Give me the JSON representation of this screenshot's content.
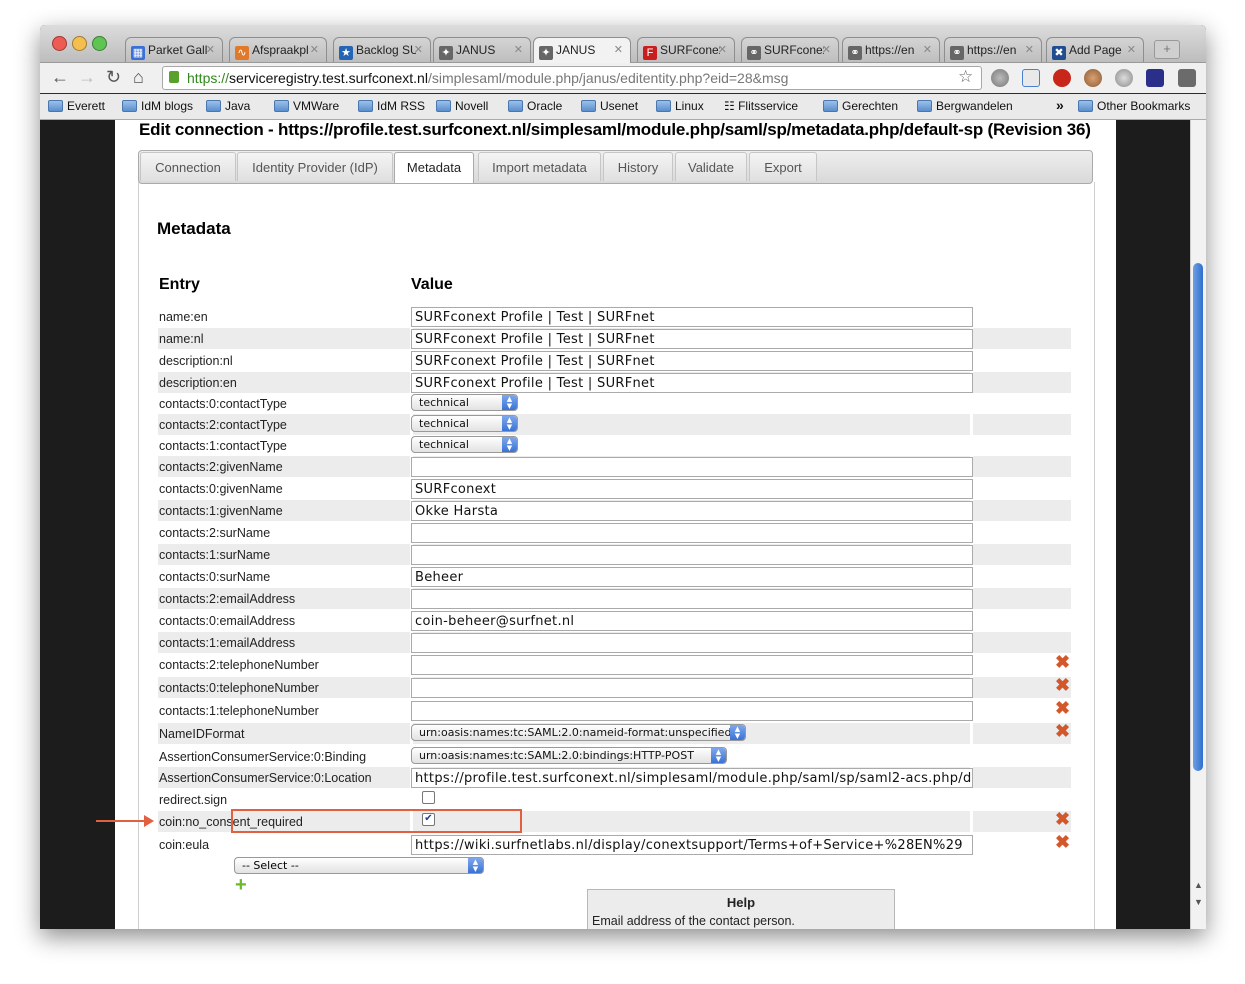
{
  "browser": {
    "tabs": [
      {
        "title": "Parket Gall",
        "icon": "calendar-icon",
        "color": "#3b6fd8"
      },
      {
        "title": "Afspraakpl",
        "icon": "wave-icon",
        "color": "#e07a2a"
      },
      {
        "title": "Backlog SU",
        "icon": "star-person-icon",
        "color": "#2563b5"
      },
      {
        "title": "JANUS",
        "icon": "janus-icon",
        "color": "#666666"
      },
      {
        "title": "JANUS",
        "icon": "janus-icon",
        "color": "#666666"
      },
      {
        "title": "SURFconex",
        "icon": "surfconext-icon",
        "color": "#c81e1e"
      },
      {
        "title": "SURFconex",
        "icon": "link-icon",
        "color": "#666666"
      },
      {
        "title": "https://en",
        "icon": "link-icon",
        "color": "#666666"
      },
      {
        "title": "https://en",
        "icon": "link-icon",
        "color": "#666666"
      },
      {
        "title": "Add Page",
        "icon": "confluence-icon",
        "color": "#1f4d8f"
      }
    ],
    "active_tab_index": 4,
    "url": {
      "scheme": "https://",
      "host": "serviceregistry.test.surfconext.nl",
      "path": "/simplesaml/module.php/janus/editentity.php?eid=28&msg"
    },
    "bookmarks": [
      "Everett",
      "IdM blogs",
      "Java",
      "VMWare",
      "IdM RSS",
      "Novell",
      "Oracle",
      "Usenet",
      "Linux",
      "Flitsservice",
      "Gerechten",
      "Bergwandelen"
    ],
    "bookmarks_more": "»",
    "other_bookmarks": "Other Bookmarks"
  },
  "page": {
    "title": "Edit connection - https://profile.test.surfconext.nl/simplesaml/module.php/saml/sp/metadata.php/default-sp (Revision 36)",
    "tabs": [
      "Connection",
      "Identity Provider (IdP)",
      "Metadata",
      "Import metadata",
      "History",
      "Validate",
      "Export"
    ],
    "active_tab": "Metadata",
    "section_title": "Metadata",
    "col_entry": "Entry",
    "col_value": "Value",
    "rows": [
      {
        "label": "name:en",
        "type": "text",
        "value": "SURFconext Profile | Test | SURFnet",
        "delete": false
      },
      {
        "label": "name:nl",
        "type": "text",
        "value": "SURFconext Profile | Test | SURFnet",
        "delete": false
      },
      {
        "label": "description:nl",
        "type": "text",
        "value": "SURFconext Profile | Test | SURFnet",
        "delete": false
      },
      {
        "label": "description:en",
        "type": "text",
        "value": "SURFconext Profile | Test | SURFnet",
        "delete": false
      },
      {
        "label": "contacts:0:contactType",
        "type": "select",
        "value": "technical",
        "delete": false
      },
      {
        "label": "contacts:2:contactType",
        "type": "select",
        "value": "technical",
        "delete": false
      },
      {
        "label": "contacts:1:contactType",
        "type": "select",
        "value": "technical",
        "delete": false
      },
      {
        "label": "contacts:2:givenName",
        "type": "text",
        "value": "",
        "delete": false
      },
      {
        "label": "contacts:0:givenName",
        "type": "text",
        "value": "SURFconext",
        "delete": false
      },
      {
        "label": "contacts:1:givenName",
        "type": "text",
        "value": "Okke Harsta",
        "delete": false
      },
      {
        "label": "contacts:2:surName",
        "type": "text",
        "value": "",
        "delete": false
      },
      {
        "label": "contacts:1:surName",
        "type": "text",
        "value": "",
        "delete": false
      },
      {
        "label": "contacts:0:surName",
        "type": "text",
        "value": "Beheer",
        "delete": false
      },
      {
        "label": "contacts:2:emailAddress",
        "type": "text",
        "value": "",
        "delete": false
      },
      {
        "label": "contacts:0:emailAddress",
        "type": "text",
        "value": "coin-beheer@surfnet.nl",
        "delete": false
      },
      {
        "label": "contacts:1:emailAddress",
        "type": "text",
        "value": "",
        "delete": false
      },
      {
        "label": "contacts:2:telephoneNumber",
        "type": "text",
        "value": "",
        "delete": true
      },
      {
        "label": "contacts:0:telephoneNumber",
        "type": "text",
        "value": "",
        "delete": true
      },
      {
        "label": "contacts:1:telephoneNumber",
        "type": "text",
        "value": "",
        "delete": true
      },
      {
        "label": "NameIDFormat",
        "type": "select",
        "value": "urn:oasis:names:tc:SAML:2.0:nameid-format:unspecified",
        "delete": true
      },
      {
        "label": "AssertionConsumerService:0:Binding",
        "type": "select",
        "value": "urn:oasis:names:tc:SAML:2.0:bindings:HTTP-POST",
        "delete": false
      },
      {
        "label": "AssertionConsumerService:0:Location",
        "type": "text",
        "value": "https://profile.test.surfconext.nl/simplesaml/module.php/saml/sp/saml2-acs.php/d",
        "delete": false
      },
      {
        "label": "redirect.sign",
        "type": "checkbox",
        "checked": false,
        "delete": false
      },
      {
        "label": "coin:no_consent_required",
        "type": "checkbox",
        "checked": true,
        "delete": true
      },
      {
        "label": "coin:eula",
        "type": "text",
        "value": "https://wiki.surfnetlabs.nl/display/conextsupport/Terms+of+Service+%28EN%29",
        "delete": true
      }
    ],
    "new_entry_select": "-- Select --",
    "help_title": "Help",
    "help_text": "Email address of the contact person."
  }
}
